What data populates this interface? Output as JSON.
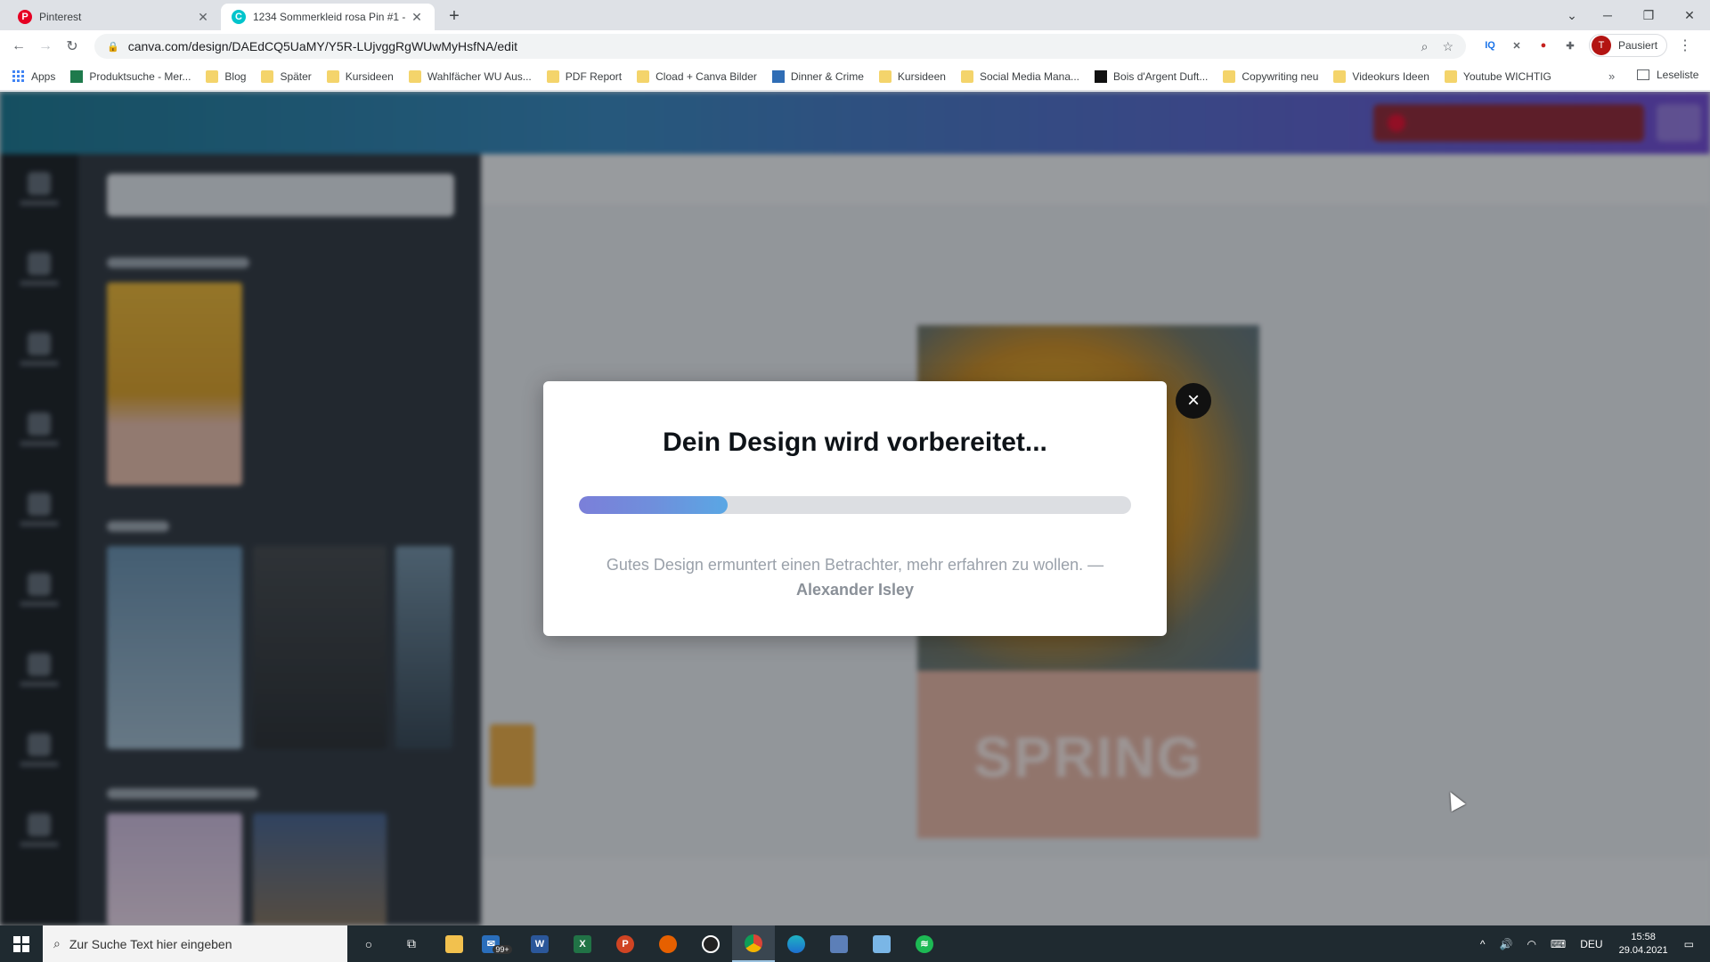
{
  "browser": {
    "tabs": [
      {
        "title": "Pinterest",
        "icon": "pinterest-icon"
      },
      {
        "title": "1234 Sommerkleid rosa Pin #1 -",
        "icon": "canva-icon"
      }
    ],
    "url": "canva.com/design/DAEdCQ5UaMY/Y5R-LUjvggRgWUwMyHsfNA/edit",
    "profile_label": "Pausiert",
    "profile_initial": "T",
    "bookmarks": [
      {
        "label": "Apps",
        "icon": "apps-grid-icon"
      },
      {
        "label": "Produktsuche - Mer...",
        "icon": "site-icon"
      },
      {
        "label": "Blog",
        "icon": "folder-icon"
      },
      {
        "label": "Später",
        "icon": "folder-icon"
      },
      {
        "label": "Kursideen",
        "icon": "folder-icon"
      },
      {
        "label": "Wahlfächer WU Aus...",
        "icon": "folder-icon"
      },
      {
        "label": "PDF Report",
        "icon": "folder-icon"
      },
      {
        "label": "Cload + Canva Bilder",
        "icon": "folder-icon"
      },
      {
        "label": "Dinner & Crime",
        "icon": "site-icon"
      },
      {
        "label": "Kursideen",
        "icon": "folder-icon"
      },
      {
        "label": "Social Media Mana...",
        "icon": "folder-icon"
      },
      {
        "label": "Bois d'Argent Duft...",
        "icon": "site-icon"
      },
      {
        "label": "Copywriting neu",
        "icon": "folder-icon"
      },
      {
        "label": "Videokurs Ideen",
        "icon": "folder-icon"
      },
      {
        "label": "Youtube WICHTIG",
        "icon": "folder-icon"
      }
    ],
    "reading_list": "Leseliste"
  },
  "canva": {
    "artboard_text": "SPRING"
  },
  "modal": {
    "title": "Dein Design wird vorbereitet...",
    "progress": 0.27,
    "quote": "Gutes Design ermuntert einen Betrachter, mehr erfahren zu wollen. —",
    "author": "Alexander Isley"
  },
  "taskbar": {
    "search_placeholder": "Zur Suche Text hier eingeben",
    "mail_badge": "99+",
    "language": "DEU",
    "time": "15:58",
    "date": "29.04.2021"
  },
  "colors": {
    "accent_gradient_start": "#7b7fd9",
    "accent_gradient_end": "#5aa7e4",
    "pinterest_red": "#e60023"
  }
}
